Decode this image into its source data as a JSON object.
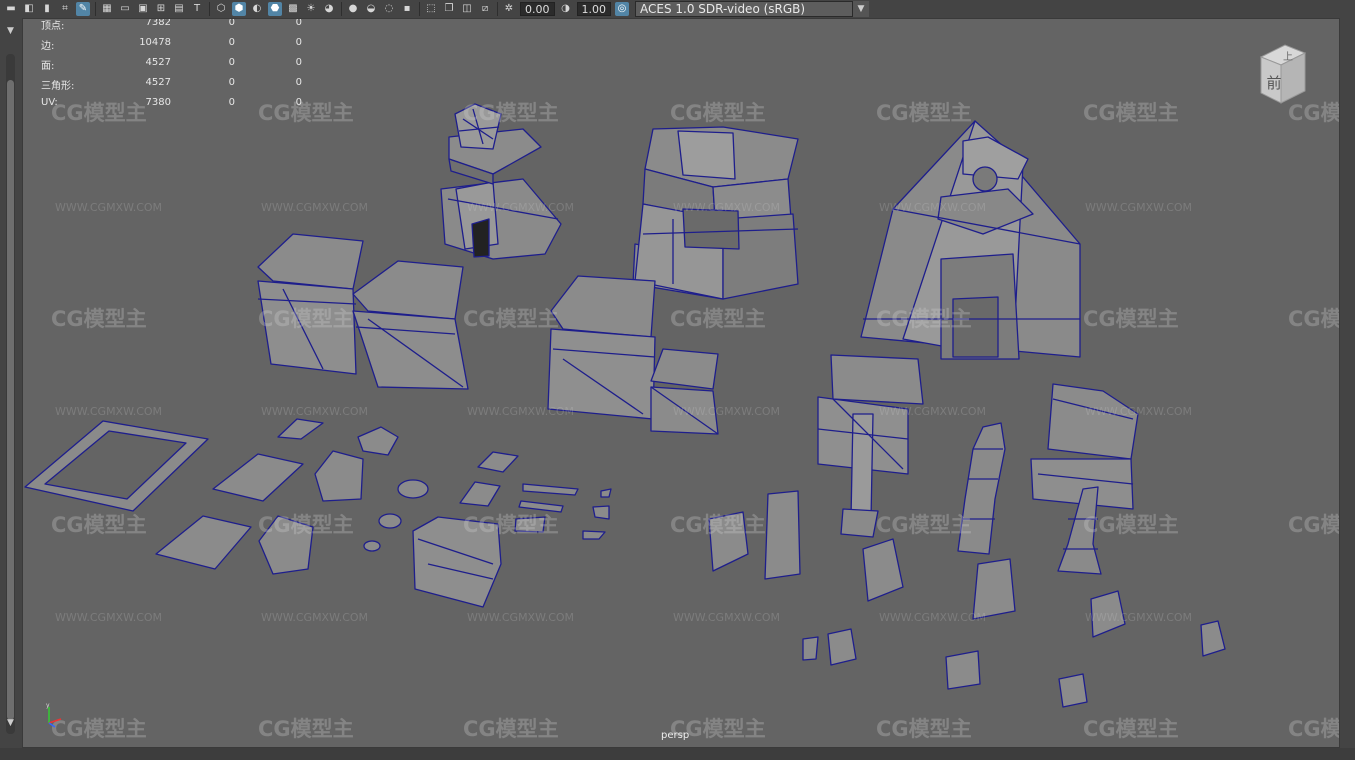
{
  "toolbar": {
    "exposure_value": "0.00",
    "gamma_value": "1.00",
    "colorspace_label": "ACES 1.0 SDR-video (sRGB)",
    "icons": [
      "camera-icon",
      "lock-camera-icon",
      "bookmark-icon",
      "image-plane-icon",
      "grid-icon",
      "film-gate-icon",
      "resolution-gate-icon",
      "gate-mask-icon",
      "field-chart-icon",
      "safe-action-icon",
      "safe-title-icon",
      "wireframe-icon",
      "smooth-shade-icon",
      "flat-shade-icon",
      "xray-icon",
      "textures-icon",
      "lighting-icon",
      "shadows-icon",
      "ambient-occlusion-icon",
      "motion-blur-icon",
      "antialias-icon",
      "depth-of-field-icon",
      "isolate-icon",
      "xray-joints-icon",
      "camera-attributes-icon",
      "exposure-icon",
      "gamma-icon",
      "color-management-icon"
    ]
  },
  "hud": {
    "rows": [
      {
        "label": "顶点:",
        "v1": "7382",
        "v2": "0",
        "v3": "0"
      },
      {
        "label": "边:",
        "v1": "10478",
        "v2": "0",
        "v3": "0"
      },
      {
        "label": "面:",
        "v1": "4527",
        "v2": "0",
        "v3": "0"
      },
      {
        "label": "三角形:",
        "v1": "4527",
        "v2": "0",
        "v3": "0"
      },
      {
        "label": "UV:",
        "v1": "7380",
        "v2": "0",
        "v3": "0"
      }
    ]
  },
  "view_cube": {
    "top_label": "上",
    "front_label": "前"
  },
  "camera_label": "persp",
  "axis": {
    "y": "y",
    "x": "x",
    "z": "z"
  },
  "watermark": {
    "logo": "CG模型主",
    "url": "WWW.CGMXW.COM"
  },
  "colors": {
    "viewport_bg": "#646464",
    "mesh_fill": "#8a8a8a",
    "wire": "#1e1e8c"
  }
}
